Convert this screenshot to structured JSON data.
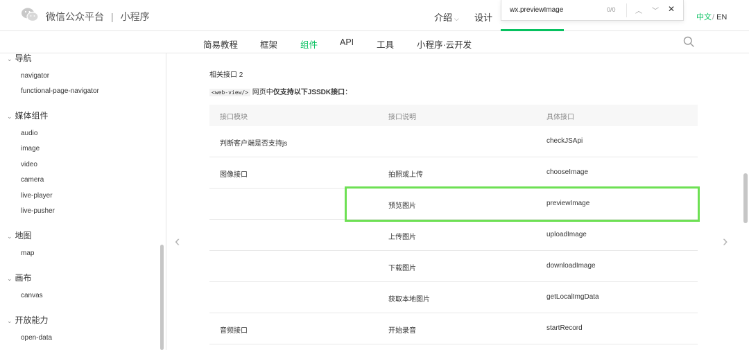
{
  "header": {
    "brand": "微信公众平台",
    "separator": "|",
    "product": "小程序",
    "nav_intro": "介绍",
    "nav_design": "设计",
    "lang_zh": "中文",
    "lang_slash": "/",
    "lang_en": "EN",
    "accent_color": "#07c160"
  },
  "find_bar": {
    "query": "wx.previewImage",
    "count": "0/0",
    "prev_icon": "chevron-up-icon",
    "next_icon": "chevron-down-icon",
    "close_icon": "close-icon"
  },
  "subnav": {
    "items": [
      "简易教程",
      "框架",
      "组件",
      "API",
      "工具",
      "小程序·云开发"
    ],
    "active": "组件",
    "search_icon": "search-icon"
  },
  "sidebar": {
    "groups": [
      {
        "label": "导航",
        "items": [
          "navigator",
          "functional-page-navigator"
        ]
      },
      {
        "label": "媒体组件",
        "items": [
          "audio",
          "image",
          "video",
          "camera",
          "live-player",
          "live-pusher"
        ]
      },
      {
        "label": "地图",
        "items": [
          "map"
        ]
      },
      {
        "label": "画布",
        "items": [
          "canvas"
        ]
      },
      {
        "label": "开放能力",
        "items": [
          "open-data"
        ]
      }
    ]
  },
  "content": {
    "section_title": "相关接口 2",
    "intro_code": "<web-view/>",
    "intro_text_pre": " 网页中",
    "intro_bold": "仅支持以下JSSDK接口",
    "intro_colon": "：",
    "table": {
      "headers": [
        "接口模块",
        "接口说明",
        "具体接口"
      ],
      "rows": [
        [
          "判断客户端是否支持js",
          "",
          "checkJSApi"
        ],
        [
          "图像接口",
          "拍照或上传",
          "chooseImage"
        ],
        [
          "",
          "预览图片",
          "previewImage"
        ],
        [
          "",
          "上传图片",
          "uploadImage"
        ],
        [
          "",
          "下载图片",
          "downloadImage"
        ],
        [
          "",
          "获取本地图片",
          "getLocalImgData"
        ],
        [
          "音频接口",
          "开始录音",
          "startRecord"
        ]
      ]
    },
    "highlight_color": "#6ee054",
    "prev_arrow": "‹",
    "next_arrow": "›"
  }
}
